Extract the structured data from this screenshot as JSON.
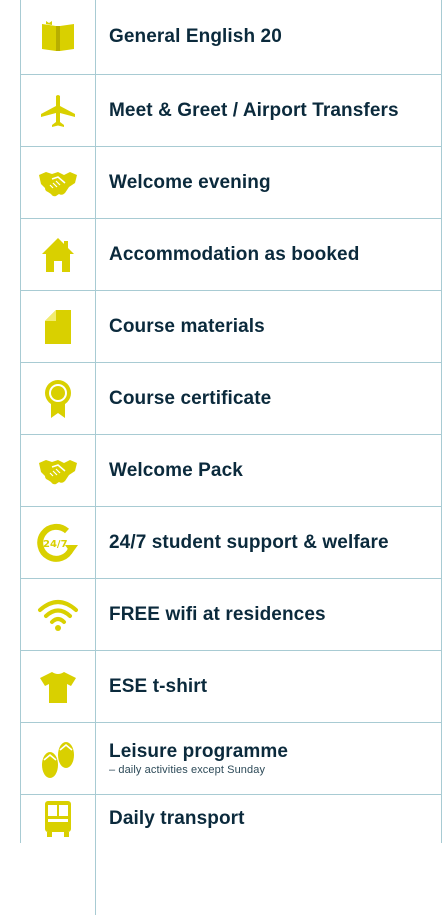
{
  "theme": {
    "icon_color": "#d9d000",
    "text_color": "#0b2a3c",
    "line_color": "#a8cbd3"
  },
  "rows": [
    {
      "icon": "book-icon",
      "label": "General English 20"
    },
    {
      "icon": "airplane-icon",
      "label": "Meet & Greet / Airport Transfers"
    },
    {
      "icon": "handshake-icon",
      "label": "Welcome evening"
    },
    {
      "icon": "house-icon",
      "label": "Accommodation as booked"
    },
    {
      "icon": "document-icon",
      "label": "Course materials"
    },
    {
      "icon": "award-ribbon-icon",
      "label": "Course certificate"
    },
    {
      "icon": "handshake-icon",
      "label": "Welcome Pack"
    },
    {
      "icon": "support-24-7-icon",
      "label": "24/7 student support & welfare"
    },
    {
      "icon": "wifi-icon",
      "label": "FREE wifi at residences"
    },
    {
      "icon": "tshirt-icon",
      "label": "ESE t-shirt"
    },
    {
      "icon": "flip-flops-icon",
      "label": "Leisure programme",
      "sublabel": "– daily activities except Sunday"
    },
    {
      "icon": "bus-icon",
      "label": "Daily transport"
    }
  ]
}
